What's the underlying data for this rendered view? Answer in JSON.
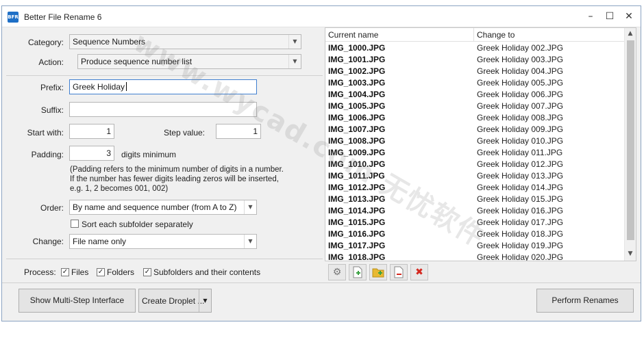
{
  "window": {
    "title": "Better File Rename 6",
    "icon_text": "BFR",
    "controls": {
      "minimize": "–",
      "maximize": "☐",
      "close": "✕"
    }
  },
  "watermark": "www.wycad.com 无忧软件",
  "form": {
    "category_label": "Category:",
    "category_value": "Sequence Numbers",
    "action_label": "Action:",
    "action_value": "Produce sequence number list",
    "prefix_label": "Prefix:",
    "prefix_value": "Greek Holiday",
    "suffix_label": "Suffix:",
    "suffix_value": "",
    "start_label": "Start with:",
    "start_value": "1",
    "step_label": "Step value:",
    "step_value": "1",
    "padding_label": "Padding:",
    "padding_value": "3",
    "padding_suffix": "digits minimum",
    "padding_note_1": "(Padding refers to the minimum number of digits in a number.",
    "padding_note_2": "If the number has fewer digits leading zeros will be inserted,",
    "padding_note_3": "e.g. 1, 2 becomes 001, 002)",
    "order_label": "Order:",
    "order_value": "By name and sequence number (from A to Z)",
    "sort_subfolder_label": "Sort each subfolder separately",
    "sort_subfolder_checked": false,
    "change_label": "Change:",
    "change_value": "File name only"
  },
  "process": {
    "label": "Process:",
    "files_label": "Files",
    "files_checked": true,
    "folders_label": "Folders",
    "folders_checked": true,
    "subfolders_label": "Subfolders and their contents",
    "subfolders_checked": true
  },
  "list": {
    "columns": [
      "Current name",
      "Change to"
    ],
    "rows": [
      [
        "IMG_1000.JPG",
        "Greek Holiday 002.JPG"
      ],
      [
        "IMG_1001.JPG",
        "Greek Holiday 003.JPG"
      ],
      [
        "IMG_1002.JPG",
        "Greek Holiday 004.JPG"
      ],
      [
        "IMG_1003.JPG",
        "Greek Holiday 005.JPG"
      ],
      [
        "IMG_1004.JPG",
        "Greek Holiday 006.JPG"
      ],
      [
        "IMG_1005.JPG",
        "Greek Holiday 007.JPG"
      ],
      [
        "IMG_1006.JPG",
        "Greek Holiday 008.JPG"
      ],
      [
        "IMG_1007.JPG",
        "Greek Holiday 009.JPG"
      ],
      [
        "IMG_1008.JPG",
        "Greek Holiday 010.JPG"
      ],
      [
        "IMG_1009.JPG",
        "Greek Holiday 011.JPG"
      ],
      [
        "IMG_1010.JPG",
        "Greek Holiday 012.JPG"
      ],
      [
        "IMG_1011.JPG",
        "Greek Holiday 013.JPG"
      ],
      [
        "IMG_1012.JPG",
        "Greek Holiday 014.JPG"
      ],
      [
        "IMG_1013.JPG",
        "Greek Holiday 015.JPG"
      ],
      [
        "IMG_1014.JPG",
        "Greek Holiday 016.JPG"
      ],
      [
        "IMG_1015.JPG",
        "Greek Holiday 017.JPG"
      ],
      [
        "IMG_1016.JPG",
        "Greek Holiday 018.JPG"
      ],
      [
        "IMG_1017.JPG",
        "Greek Holiday 019.JPG"
      ],
      [
        "IMG_1018.JPG",
        "Greek Holiday 020.JPG"
      ]
    ]
  },
  "toolbar_icons": [
    "gear-icon",
    "add-file-icon",
    "add-folder-icon",
    "remove-icon",
    "clear-all-icon"
  ],
  "buttons": {
    "multi_step": "Show Multi-Step Interface",
    "create_droplet": "Create Droplet ...",
    "perform": "Perform Renames"
  },
  "colors": {
    "accent": "#1e6fc6",
    "delete_red": "#d4281f",
    "add_green": "#3aa142",
    "folder_yellow": "#e8b931"
  }
}
